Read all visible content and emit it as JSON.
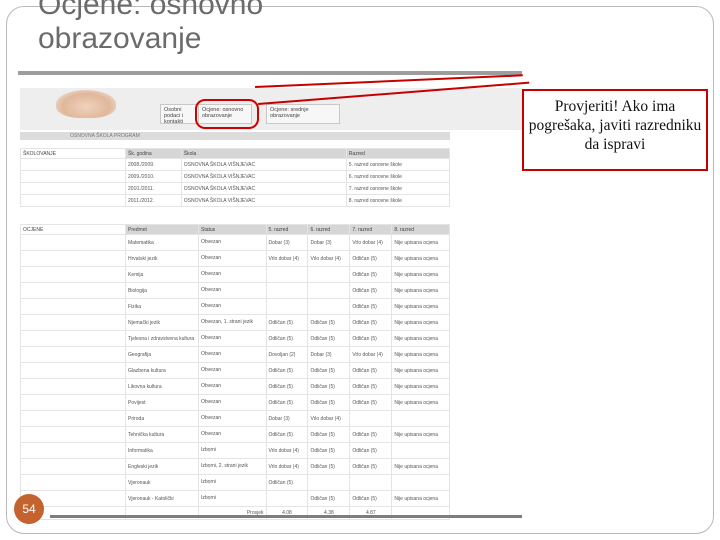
{
  "slide": {
    "title_line1": "Ocjene: osnovno",
    "title_line2": "obrazovanje",
    "page_number": "54"
  },
  "screenshot": {
    "tabs": [
      "Osobni podaci i kontakti",
      "Ocjene: osnovno obrazovanje",
      "Ocjene: srednje obrazovanje"
    ],
    "section_header": "OSNOVNA ŠKOLA  PROGRAM",
    "schooling_table": {
      "label": "ŠKOLOVANJE",
      "columns": [
        "Šk. godina",
        "Škola",
        "Razred"
      ],
      "rows": [
        [
          "2008./2009.",
          "OSNOVNA ŠKOLA VIŠNJEVAC",
          "5. razred osnovne škole"
        ],
        [
          "2009./2010.",
          "OSNOVNA ŠKOLA VIŠNJEVAC",
          "6. razred osnovne škole"
        ],
        [
          "2010./2011.",
          "OSNOVNA ŠKOLA VIŠNJEVAC",
          "7. razred osnovne škole"
        ],
        [
          "2011./2012.",
          "OSNOVNA ŠKOLA VIŠNJEVAC",
          "8. razred osnovne škole"
        ]
      ]
    },
    "grades_table": {
      "label": "OCJENE",
      "columns": [
        "Predmet",
        "Status",
        "5. razred",
        "6. razred",
        "7. razred",
        "8. razred"
      ],
      "rows": [
        [
          "Matematika",
          "Obvezan",
          "Dobar (3)",
          "Dobar (3)",
          "Vrlo dobar (4)",
          "Nije upisana ocjena"
        ],
        [
          "Hrvatski jezik",
          "Obvezan",
          "Vrlo dobar (4)",
          "Vrlo dobar (4)",
          "Odličan (5)",
          "Nije upisana ocjena"
        ],
        [
          "Kemija",
          "Obvezan",
          "",
          "",
          "Odličan (5)",
          "Nije upisana ocjena"
        ],
        [
          "Biologija",
          "Obvezan",
          "",
          "",
          "Odličan (5)",
          "Nije upisana ocjena"
        ],
        [
          "Fizika",
          "Obvezan",
          "",
          "",
          "Odličan (5)",
          "Nije upisana ocjena"
        ],
        [
          "Njemački jezik",
          "Obvezan, 1. strani jezik",
          "Odličan (5)",
          "Odličan (5)",
          "Odličan (5)",
          "Nije upisana ocjena"
        ],
        [
          "Tjelesna i zdravstvena kultura",
          "Obvezan",
          "Odličan (5)",
          "Odličan (5)",
          "Odličan (5)",
          "Nije upisana ocjena"
        ],
        [
          "Geografija",
          "Obvezan",
          "Dovoljan (2)",
          "Dobar (3)",
          "Vrlo dobar (4)",
          "Nije upisana ocjena"
        ],
        [
          "Glazbena kultura",
          "Obvezan",
          "Odličan (5)",
          "Odličan (5)",
          "Odličan (5)",
          "Nije upisana ocjena"
        ],
        [
          "Likovna kultura",
          "Obvezan",
          "Odličan (5)",
          "Odličan (5)",
          "Odličan (5)",
          "Nije upisana ocjena"
        ],
        [
          "Povijest",
          "Obvezan",
          "Odličan (5)",
          "Odličan (5)",
          "Odličan (5)",
          "Nije upisana ocjena"
        ],
        [
          "Priroda",
          "Obvezan",
          "Dobar (3)",
          "Vrlo dobar (4)",
          "",
          ""
        ],
        [
          "Tehnička kultura",
          "Obvezan",
          "Odličan (5)",
          "Odličan (5)",
          "Odličan (5)",
          "Nije upisana ocjena"
        ],
        [
          "Informatika",
          "Izborni",
          "Vrlo dobar (4)",
          "Odličan (5)",
          "Odličan (5)",
          ""
        ],
        [
          "Engleski jezik",
          "Izborni, 2. strani jezik",
          "Vrlo dobar (4)",
          "Odličan (5)",
          "Odličan (5)",
          "Nije upisana ocjena"
        ],
        [
          "Vjeronauk",
          "Izborni",
          "Odličan (5)",
          "",
          "",
          ""
        ],
        [
          "Vjeronauk - Katolički",
          "Izborni",
          "",
          "Odličan (5)",
          "Odličan (5)",
          "Nije upisana ocjena"
        ]
      ],
      "average_label": "Prosjek",
      "averages": [
        "4.08",
        "4.38",
        "4.87",
        ""
      ]
    }
  },
  "callout": {
    "text": "Provjeriti! Ako ima pogrešaka, javiti razredniku da ispravi"
  },
  "colors": {
    "annotation": "#c40000",
    "badge": "#c4632f"
  }
}
